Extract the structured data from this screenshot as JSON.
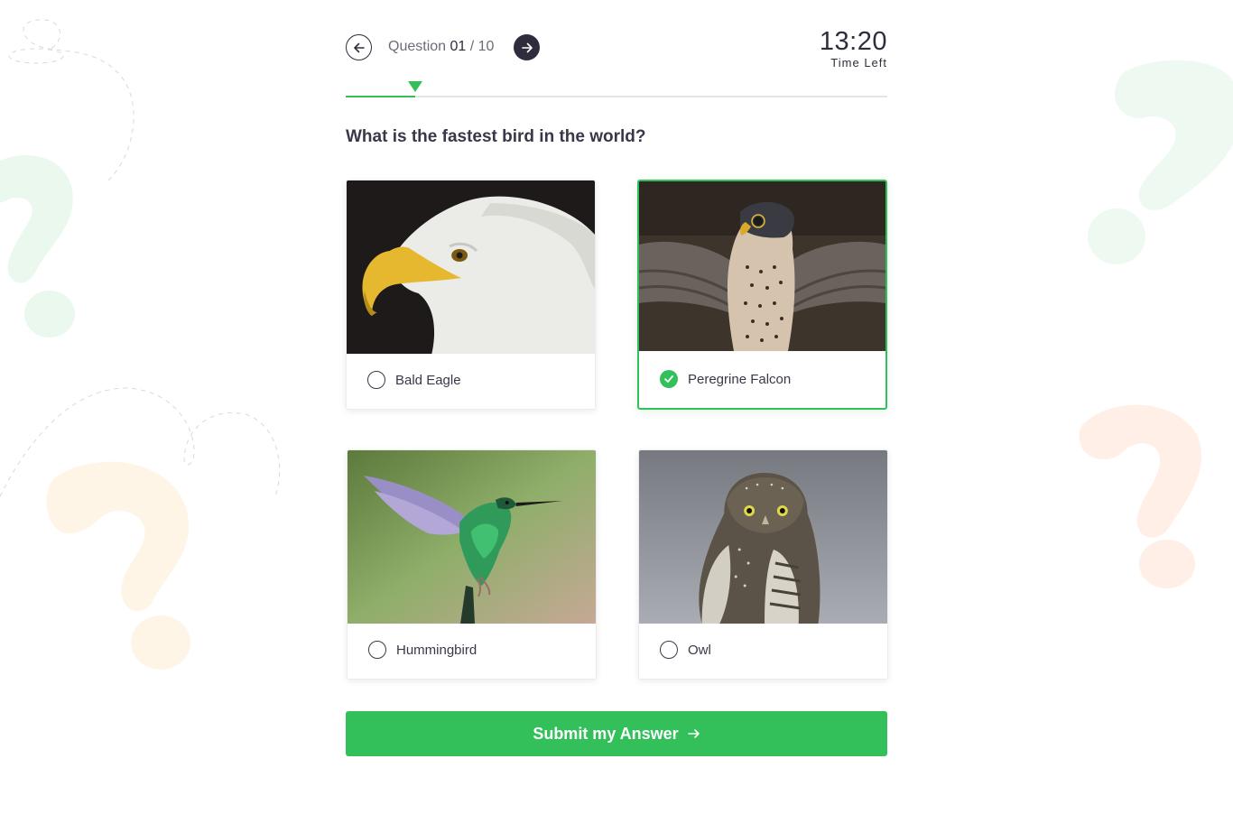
{
  "nav": {
    "prev_icon": "arrow-left-icon",
    "next_icon": "arrow-right-icon",
    "question_word": "Question",
    "current": "01",
    "separator": "/",
    "total": "10"
  },
  "timer": {
    "value": "13:20",
    "label": "Time Left"
  },
  "progress": {
    "fraction": 0.128
  },
  "question": "What is the fastest bird in the world?",
  "options": [
    {
      "label": "Bald Eagle",
      "selected": false,
      "image": "bald-eagle-photo"
    },
    {
      "label": "Peregrine Falcon",
      "selected": true,
      "image": "peregrine-falcon-photo"
    },
    {
      "label": "Hummingbird",
      "selected": false,
      "image": "hummingbird-photo"
    },
    {
      "label": "Owl",
      "selected": false,
      "image": "owl-photo"
    }
  ],
  "submit": {
    "label": "Submit my Answer",
    "icon": "arrow-right-icon"
  },
  "colors": {
    "accent": "#33c05b",
    "dark": "#2f2d3d",
    "text": "#3a3848"
  }
}
